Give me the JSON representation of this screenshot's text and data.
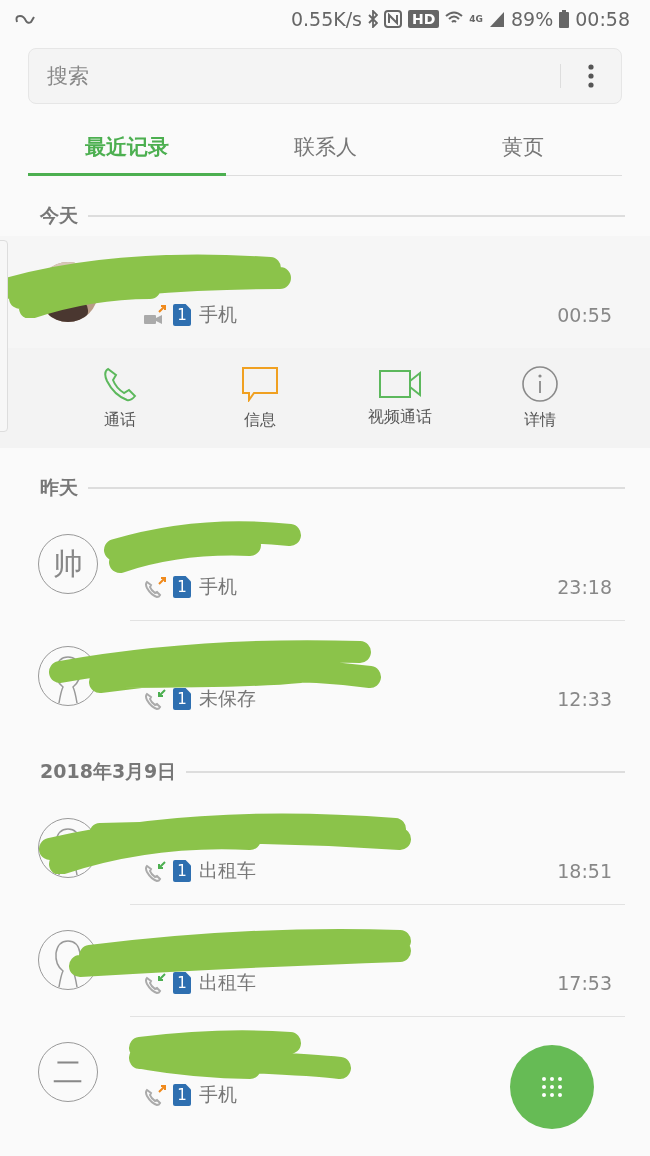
{
  "status_bar": {
    "speed": "0.55K/s",
    "hd": "HD",
    "network": "4G",
    "battery": "89%",
    "time": "00:58"
  },
  "search": {
    "placeholder": "搜索"
  },
  "tabs": [
    {
      "label": "最近记录",
      "selected": true
    },
    {
      "label": "联系人",
      "selected": false
    },
    {
      "label": "黄页",
      "selected": false
    }
  ],
  "sections": [
    {
      "header": "今天",
      "entries": [
        {
          "call_icon": {
            "kind": "outgoing-video"
          },
          "sim": "1",
          "label": "手机",
          "time": "00:55",
          "expanded": true,
          "actions": [
            {
              "kind": "call",
              "label": "通话",
              "color": "#5cb85c"
            },
            {
              "kind": "message",
              "label": "信息",
              "color": "#f0a020"
            },
            {
              "kind": "video",
              "label": "视频通话",
              "color": "#5cb85c"
            },
            {
              "kind": "details",
              "label": "详情",
              "color": "#8a8a8a"
            }
          ]
        }
      ]
    },
    {
      "header": "昨天",
      "entries": [
        {
          "avatar": {
            "kind": "letter",
            "letter": "帅"
          },
          "call_icon": {
            "kind": "outgoing"
          },
          "sim": "1",
          "label": "手机",
          "time": "23:18"
        },
        {
          "avatar": {
            "kind": "silhouette"
          },
          "call_icon": {
            "kind": "incoming"
          },
          "sim": "1",
          "label": "未保存",
          "time": "12:33"
        }
      ]
    },
    {
      "header": "2018年3月9日",
      "entries": [
        {
          "avatar": {
            "kind": "silhouette"
          },
          "call_icon": {
            "kind": "incoming"
          },
          "sim": "1",
          "label": "出租车",
          "time": "18:51"
        },
        {
          "avatar": {
            "kind": "silhouette"
          },
          "call_icon": {
            "kind": "incoming"
          },
          "sim": "1",
          "label": "出租车",
          "time": "17:53"
        },
        {
          "avatar": {
            "kind": "letter",
            "letter": "二"
          },
          "call_icon": {
            "kind": "outgoing"
          },
          "sim": "1",
          "label": "手机"
        }
      ]
    }
  ]
}
